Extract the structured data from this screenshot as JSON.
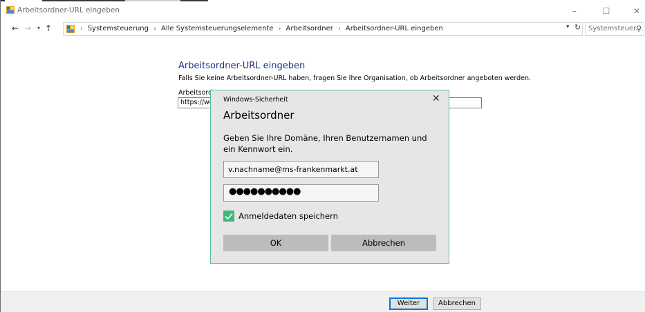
{
  "window": {
    "title": "Arbeitsordner-URL eingeben",
    "minimize": "–",
    "maximize": "☐",
    "close": "✕"
  },
  "nav": {
    "back": "←",
    "forward": "→",
    "recent": "▾",
    "up": "↑",
    "breadcrumbs": [
      "Systemsteuerung",
      "Alle Systemsteuerungselemente",
      "Arbeitsordner",
      "Arbeitsordner-URL eingeben"
    ],
    "separator": "›",
    "dropdown": "▾",
    "refresh": "↻",
    "search_placeholder": "Systemsteuer...",
    "search_icon": "⚲"
  },
  "content": {
    "heading": "Arbeitsordner-URL eingeben",
    "description": "Falls Sie keine Arbeitsordner-URL haben, fragen Sie Ihre Organisation, ob Arbeitsordner angeboten werden.",
    "url_label": "Arbeitsordner-URL:",
    "url_value": "https://workfolders"
  },
  "footer": {
    "next": "Weiter",
    "cancel": "Abbrechen"
  },
  "dialog": {
    "caption": "Windows-Sicherheit",
    "close": "✕",
    "title": "Arbeitsordner",
    "text": "Geben Sie Ihre Domäne, Ihren Benutzernamen und ein Kennwort ein.",
    "username": "v.nachname@ms-frankenmarkt.at",
    "password_mask": "●●●●●●●●●●",
    "remember_label": "Anmeldedaten speichern",
    "remember_checked": true,
    "ok": "OK",
    "cancel": "Abbrechen",
    "accent_color": "#43b77a"
  }
}
